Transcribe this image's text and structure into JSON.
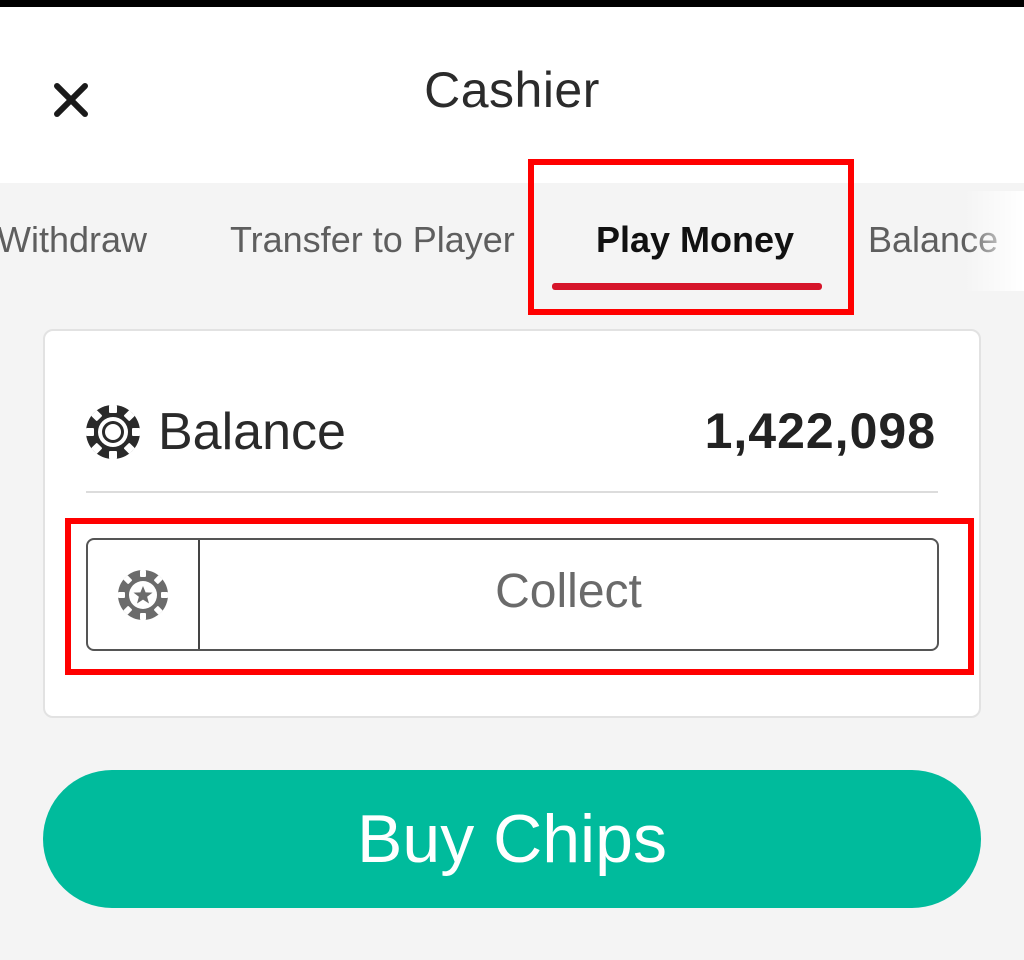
{
  "header": {
    "title": "Cashier",
    "close_icon": "close-icon"
  },
  "tabs": [
    {
      "label": "Withdraw",
      "active": false
    },
    {
      "label": "Transfer to Player",
      "active": false
    },
    {
      "label": "Play Money",
      "active": true
    },
    {
      "label": "Balance",
      "active": false
    }
  ],
  "balance_card": {
    "label": "Balance",
    "value": "1,422,098",
    "icon": "poker-chip-icon"
  },
  "collect": {
    "label": "Collect",
    "icon": "chip-star-icon"
  },
  "buy": {
    "label": "Buy Chips"
  },
  "colors": {
    "accent_tab": "#d6152a",
    "buy_button": "#00bb9c",
    "highlight": "#ff0000"
  }
}
